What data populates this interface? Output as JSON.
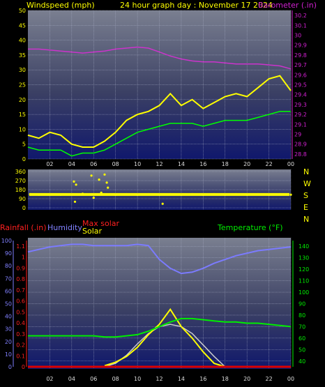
{
  "header": {
    "wind_label": "Windspeed (mph)",
    "title": "24 hour graph day : November 17 2024",
    "baro_label": "Barometer (.in)"
  },
  "compass": [
    "N",
    "W",
    "S",
    "E",
    "N"
  ],
  "bottom_labels": {
    "rain": "Rainfall (.in)",
    "humidity": "Humidity",
    "maxsolar": "Max solar",
    "solar": "Solar",
    "temp": "Temperature (°F)"
  },
  "colors": {
    "wind": "#ffff00",
    "gust_low": "#00ff00",
    "baro": "#cc33cc",
    "dir": "#ffff00",
    "humidity": "#7b7bff",
    "temp": "#00ee00",
    "solar": "#ffff00",
    "maxsolar": "#cccccc",
    "rain": "#dd0000",
    "label_wind": "#ffff00",
    "label_baro": "#d020d0",
    "label_rain": "#ff2020",
    "label_hum": "#8080ff",
    "label_temp": "#00ee00"
  },
  "x_ticks": [
    "02",
    "04",
    "06",
    "08",
    "10",
    "12",
    "14",
    "16",
    "18",
    "20",
    "22",
    "00"
  ],
  "chart_data": [
    {
      "type": "line",
      "name": "wind-baro",
      "x_range_hours": [
        0,
        24
      ],
      "y_left_ticks": [
        "0",
        "5",
        "10",
        "15",
        "20",
        "25",
        "30",
        "35",
        "40",
        "45",
        "50"
      ],
      "y_left_range": [
        0,
        50
      ],
      "y_right_ticks": [
        "28.8",
        "28.9",
        "29",
        "29.1",
        "29.2",
        "29.3",
        "29.4",
        "29.5",
        "29.6",
        "29.7",
        "29.8",
        "29.9",
        "30",
        "30.1",
        "30.2"
      ],
      "y_right_range": [
        28.75,
        30.25
      ],
      "series": [
        {
          "name": "Windspeed",
          "axis": "left",
          "x": [
            0,
            1,
            2,
            3,
            4,
            5,
            6,
            7,
            8,
            9,
            10,
            11,
            12,
            13,
            14,
            15,
            16,
            17,
            18,
            19,
            20,
            21,
            22,
            23,
            24
          ],
          "values": [
            8,
            7,
            9,
            8,
            5,
            4,
            4,
            6,
            9,
            13,
            15,
            16,
            18,
            22,
            18,
            20,
            17,
            19,
            21,
            22,
            21,
            24,
            27,
            28,
            23
          ]
        },
        {
          "name": "Wind low",
          "axis": "left",
          "x": [
            0,
            1,
            2,
            3,
            4,
            5,
            6,
            7,
            8,
            9,
            10,
            11,
            12,
            13,
            14,
            15,
            16,
            17,
            18,
            19,
            20,
            21,
            22,
            23,
            24
          ],
          "values": [
            4,
            3,
            3,
            3,
            1,
            2,
            2,
            3,
            5,
            7,
            9,
            10,
            11,
            12,
            12,
            12,
            11,
            12,
            13,
            13,
            13,
            14,
            15,
            16,
            16
          ]
        },
        {
          "name": "Barometer",
          "axis": "right",
          "x": [
            0,
            1,
            2,
            3,
            4,
            5,
            6,
            7,
            8,
            9,
            10,
            11,
            12,
            13,
            14,
            15,
            16,
            17,
            18,
            19,
            20,
            21,
            22,
            23,
            24
          ],
          "values": [
            29.86,
            29.86,
            29.85,
            29.84,
            29.83,
            29.82,
            29.83,
            29.84,
            29.86,
            29.87,
            29.88,
            29.87,
            29.83,
            29.79,
            29.76,
            29.74,
            29.73,
            29.73,
            29.72,
            29.71,
            29.71,
            29.71,
            29.7,
            29.69,
            29.66
          ]
        }
      ]
    },
    {
      "type": "scatter",
      "name": "wind-direction",
      "y_ticks": [
        "360",
        "270",
        "180",
        "90",
        "0"
      ],
      "y_range": [
        0,
        360
      ],
      "series": [
        {
          "name": "Direction",
          "points": [
            [
              0.2,
              135
            ],
            [
              1,
              130
            ],
            [
              2,
              135
            ],
            [
              3,
              130
            ],
            [
              4,
              135
            ],
            [
              4.2,
              260
            ],
            [
              4.4,
              230
            ],
            [
              5,
              140
            ],
            [
              5.8,
              320
            ],
            [
              6.5,
              280
            ],
            [
              7,
              330
            ],
            [
              7.2,
              250
            ],
            [
              7.3,
              200
            ],
            [
              6.7,
              150
            ],
            [
              6,
              100
            ],
            [
              4.3,
              60
            ],
            [
              8,
              130
            ],
            [
              9,
              135
            ],
            [
              10,
              130
            ],
            [
              11,
              135
            ],
            [
              12,
              130
            ],
            [
              12.3,
              40
            ],
            [
              13,
              135
            ],
            [
              14,
              130
            ],
            [
              15,
              135
            ],
            [
              16,
              130
            ],
            [
              17,
              135
            ],
            [
              18,
              130
            ],
            [
              19,
              135
            ],
            [
              20,
              130
            ],
            [
              21,
              135
            ],
            [
              22,
              130
            ],
            [
              23,
              135
            ],
            [
              24,
              130
            ]
          ]
        }
      ]
    },
    {
      "type": "line",
      "name": "temp-humidity-solar",
      "y_left_rain_ticks": [
        "0",
        "0.1",
        "0.2",
        "0.3",
        "0.4",
        "0.5",
        "0.6",
        "0.7",
        "0.8",
        "0.9",
        "1",
        "1.1"
      ],
      "y_left_hum_ticks": [
        "100",
        "90",
        "80",
        "70",
        "60",
        "50",
        "40",
        "30",
        "20",
        "10",
        "0"
      ],
      "y_right_ticks": [
        "40",
        "50",
        "60",
        "70",
        "80",
        "90",
        "100",
        "110",
        "120",
        "130",
        "140"
      ],
      "y_right_range": [
        35,
        145
      ],
      "series": [
        {
          "name": "Humidity",
          "axis": "hum",
          "x": [
            0,
            1,
            2,
            3,
            4,
            5,
            6,
            7,
            8,
            9,
            10,
            11,
            12,
            13,
            14,
            15,
            16,
            17,
            18,
            19,
            20,
            21,
            22,
            23,
            24
          ],
          "values": [
            91,
            93,
            95,
            96,
            97,
            97,
            96,
            96,
            96,
            96,
            97,
            96,
            85,
            78,
            74,
            75,
            78,
            82,
            85,
            88,
            90,
            92,
            93,
            94,
            95
          ]
        },
        {
          "name": "Temperature",
          "axis": "right",
          "x": [
            0,
            1,
            2,
            3,
            4,
            5,
            6,
            7,
            8,
            9,
            10,
            11,
            12,
            13,
            14,
            15,
            16,
            17,
            18,
            19,
            20,
            21,
            22,
            23,
            24
          ],
          "values": [
            62,
            62,
            62,
            62,
            62,
            62,
            62,
            61,
            61,
            62,
            63,
            66,
            70,
            74,
            77,
            77,
            76,
            75,
            74,
            74,
            73,
            73,
            72,
            71,
            70
          ]
        },
        {
          "name": "Max solar",
          "axis": "right",
          "x": [
            7,
            8,
            9,
            10,
            11,
            12,
            13,
            14,
            15,
            16,
            17,
            18
          ],
          "values": [
            35,
            38,
            45,
            55,
            64,
            70,
            72,
            70,
            64,
            54,
            44,
            35
          ]
        },
        {
          "name": "Solar",
          "axis": "right",
          "x": [
            7,
            8,
            9,
            10,
            11,
            12,
            13,
            14,
            15,
            16,
            17,
            18
          ],
          "values": [
            36,
            39,
            44,
            52,
            63,
            72,
            85,
            70,
            60,
            48,
            38,
            35
          ]
        },
        {
          "name": "Rainfall",
          "axis": "rain",
          "x": [
            0,
            24
          ],
          "values": [
            0,
            0
          ]
        }
      ]
    }
  ]
}
